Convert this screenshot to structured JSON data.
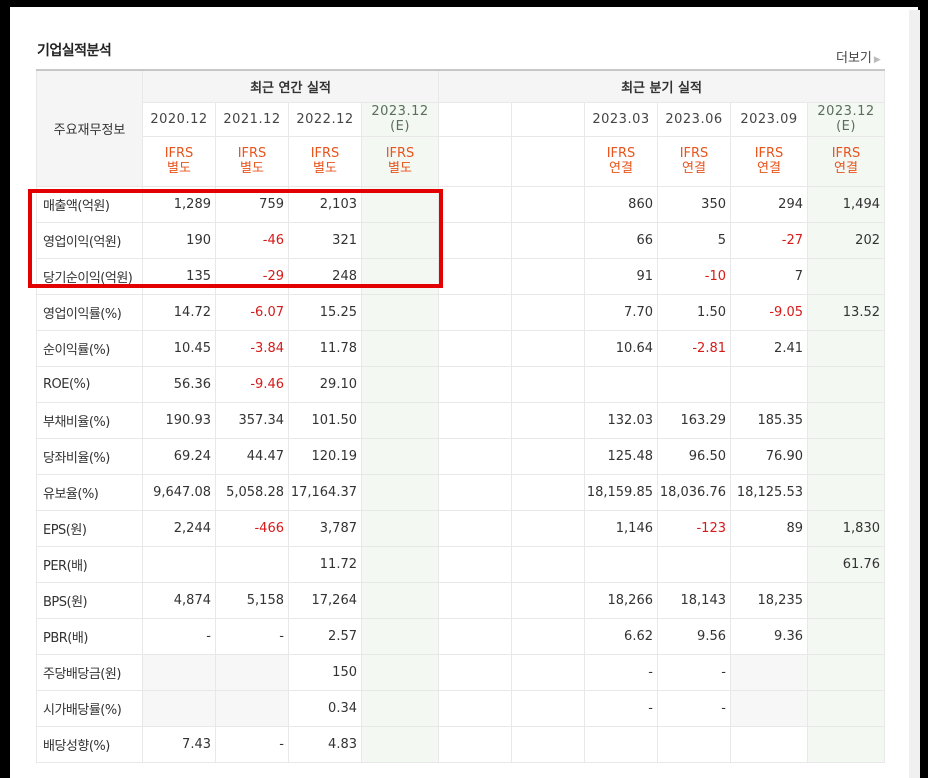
{
  "section_title": "기업실적분석",
  "more_label": "더보기",
  "header": {
    "corner_label": "주요재무정보",
    "annual_title": "최근 연간 실적",
    "quarter_title": "최근 분기 실적",
    "annual_periods": [
      {
        "main": "2020.12",
        "sub": ""
      },
      {
        "main": "2021.12",
        "sub": ""
      },
      {
        "main": "2022.12",
        "sub": ""
      },
      {
        "main": "2023.12",
        "sub": "(E)"
      }
    ],
    "quarter_periods": [
      {
        "main": "",
        "sub": ""
      },
      {
        "main": "",
        "sub": ""
      },
      {
        "main": "2023.03",
        "sub": ""
      },
      {
        "main": "2023.06",
        "sub": ""
      },
      {
        "main": "2023.09",
        "sub": ""
      },
      {
        "main": "2023.12",
        "sub": "(E)"
      }
    ],
    "annual_ifrs": [
      {
        "l1": "IFRS",
        "l2": "별도"
      },
      {
        "l1": "IFRS",
        "l2": "별도"
      },
      {
        "l1": "IFRS",
        "l2": "별도"
      },
      {
        "l1": "IFRS",
        "l2": "별도"
      }
    ],
    "quarter_ifrs": [
      {
        "l1": "",
        "l2": ""
      },
      {
        "l1": "",
        "l2": ""
      },
      {
        "l1": "IFRS",
        "l2": "연결"
      },
      {
        "l1": "IFRS",
        "l2": "연결"
      },
      {
        "l1": "IFRS",
        "l2": "연결"
      },
      {
        "l1": "IFRS",
        "l2": "연결"
      }
    ]
  },
  "rows": [
    {
      "label": "매출액(억원)",
      "values": [
        "1,289",
        "759",
        "2,103",
        "",
        "",
        "",
        "860",
        "350",
        "294",
        "1,494"
      ],
      "neg": [
        false,
        false,
        false,
        false,
        false,
        false,
        false,
        false,
        false,
        false
      ],
      "group_start": true
    },
    {
      "label": "영업이익(억원)",
      "values": [
        "190",
        "-46",
        "321",
        "",
        "",
        "",
        "66",
        "5",
        "-27",
        "202"
      ],
      "neg": [
        false,
        true,
        false,
        false,
        false,
        false,
        false,
        false,
        true,
        false
      ],
      "group_start": false
    },
    {
      "label": "당기순이익(억원)",
      "values": [
        "135",
        "-29",
        "248",
        "",
        "",
        "",
        "91",
        "-10",
        "7",
        ""
      ],
      "neg": [
        false,
        true,
        false,
        false,
        false,
        false,
        false,
        true,
        false,
        false
      ],
      "group_start": false
    },
    {
      "label": "영업이익률(%)",
      "values": [
        "14.72",
        "-6.07",
        "15.25",
        "",
        "",
        "",
        "7.70",
        "1.50",
        "-9.05",
        "13.52"
      ],
      "neg": [
        false,
        true,
        false,
        false,
        false,
        false,
        false,
        false,
        true,
        false
      ],
      "group_start": true
    },
    {
      "label": "순이익률(%)",
      "values": [
        "10.45",
        "-3.84",
        "11.78",
        "",
        "",
        "",
        "10.64",
        "-2.81",
        "2.41",
        ""
      ],
      "neg": [
        false,
        true,
        false,
        false,
        false,
        false,
        false,
        true,
        false,
        false
      ],
      "group_start": false
    },
    {
      "label": "ROE(%)",
      "values": [
        "56.36",
        "-9.46",
        "29.10",
        "",
        "",
        "",
        "",
        "",
        "",
        ""
      ],
      "neg": [
        false,
        true,
        false,
        false,
        false,
        false,
        false,
        false,
        false,
        false
      ],
      "group_start": false
    },
    {
      "label": "부채비율(%)",
      "values": [
        "190.93",
        "357.34",
        "101.50",
        "",
        "",
        "",
        "132.03",
        "163.29",
        "185.35",
        ""
      ],
      "neg": [
        false,
        false,
        false,
        false,
        false,
        false,
        false,
        false,
        false,
        false
      ],
      "group_start": true
    },
    {
      "label": "당좌비율(%)",
      "values": [
        "69.24",
        "44.47",
        "120.19",
        "",
        "",
        "",
        "125.48",
        "96.50",
        "76.90",
        ""
      ],
      "neg": [
        false,
        false,
        false,
        false,
        false,
        false,
        false,
        false,
        false,
        false
      ],
      "group_start": false
    },
    {
      "label": "유보율(%)",
      "values": [
        "9,647.08",
        "5,058.28",
        "17,164.37",
        "",
        "",
        "",
        "18,159.85",
        "18,036.76",
        "18,125.53",
        ""
      ],
      "neg": [
        false,
        false,
        false,
        false,
        false,
        false,
        false,
        false,
        false,
        false
      ],
      "group_start": false
    },
    {
      "label": "EPS(원)",
      "values": [
        "2,244",
        "-466",
        "3,787",
        "",
        "",
        "",
        "1,146",
        "-123",
        "89",
        "1,830"
      ],
      "neg": [
        false,
        true,
        false,
        false,
        false,
        false,
        false,
        true,
        false,
        false
      ],
      "group_start": true
    },
    {
      "label": "PER(배)",
      "values": [
        "",
        "",
        "11.72",
        "",
        "",
        "",
        "",
        "",
        "",
        "61.76"
      ],
      "neg": [
        false,
        false,
        false,
        false,
        false,
        false,
        false,
        false,
        false,
        false
      ],
      "group_start": false
    },
    {
      "label": "BPS(원)",
      "values": [
        "4,874",
        "5,158",
        "17,264",
        "",
        "",
        "",
        "18,266",
        "18,143",
        "18,235",
        ""
      ],
      "neg": [
        false,
        false,
        false,
        false,
        false,
        false,
        false,
        false,
        false,
        false
      ],
      "group_start": false
    },
    {
      "label": "PBR(배)",
      "values": [
        "-",
        "-",
        "2.57",
        "",
        "",
        "",
        "6.62",
        "9.56",
        "9.36",
        ""
      ],
      "neg": [
        false,
        false,
        false,
        false,
        false,
        false,
        false,
        false,
        false,
        false
      ],
      "group_start": false
    },
    {
      "label": "주당배당금(원)",
      "values": [
        "",
        "",
        "150",
        "",
        "",
        "",
        "-",
        "-",
        "",
        ""
      ],
      "neg": [
        false,
        false,
        false,
        false,
        false,
        false,
        false,
        false,
        false,
        false
      ],
      "blank": [
        true,
        true,
        false,
        false,
        false,
        false,
        false,
        false,
        true,
        false
      ],
      "group_start": true
    },
    {
      "label": "시가배당률(%)",
      "values": [
        "",
        "",
        "0.34",
        "",
        "",
        "",
        "-",
        "-",
        "",
        ""
      ],
      "neg": [
        false,
        false,
        false,
        false,
        false,
        false,
        false,
        false,
        false,
        false
      ],
      "blank": [
        true,
        true,
        false,
        false,
        false,
        false,
        false,
        false,
        true,
        false
      ],
      "group_start": false
    },
    {
      "label": "배당성향(%)",
      "values": [
        "7.43",
        "-",
        "4.83",
        "",
        "",
        "",
        "",
        "",
        "",
        ""
      ],
      "neg": [
        false,
        false,
        false,
        false,
        false,
        false,
        false,
        false,
        false,
        false
      ],
      "group_start": false
    }
  ],
  "estimate_columns": [
    3,
    9
  ],
  "colors": {
    "negative": "#d61a1a",
    "ifrs": "#e8541c",
    "highlight_box": "#e20000",
    "estimate_bg": "#f3f8f3"
  }
}
